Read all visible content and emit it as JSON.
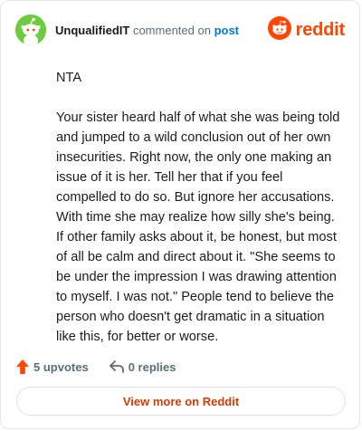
{
  "comment": {
    "username": "UnqualifiedIT",
    "action_text": " commented on ",
    "post_link": "post",
    "avatar_icon": "snoo-avatar-icon",
    "avatar_color": "#6ecb3f",
    "paragraphs": [
      "NTA",
      "Your sister heard half of what she was being told and jumped to a wild conclusion out of her own insecurities. Right now, the only one making an issue of it is her. Tell her that if you feel compelled to do so. But ignore her accusations. With time she may realize how silly she's being. If other family asks about it, be honest, but most of all be calm and direct about it. \"She seems to be under the impression I was drawing attention to myself. I was not.\" People tend to believe the person who doesn't get dramatic in a situation like this, for better or worse."
    ]
  },
  "brand": {
    "name": "reddit",
    "icon": "reddit-logo-icon",
    "color": "#ff4500"
  },
  "actions": {
    "upvotes_label": "5 upvotes",
    "upvote_icon": "upvote-arrow-icon",
    "upvote_color": "#ff4500",
    "replies_label": "0 replies",
    "reply_icon": "reply-arrow-icon"
  },
  "footer": {
    "view_more_label": "View more on Reddit"
  }
}
